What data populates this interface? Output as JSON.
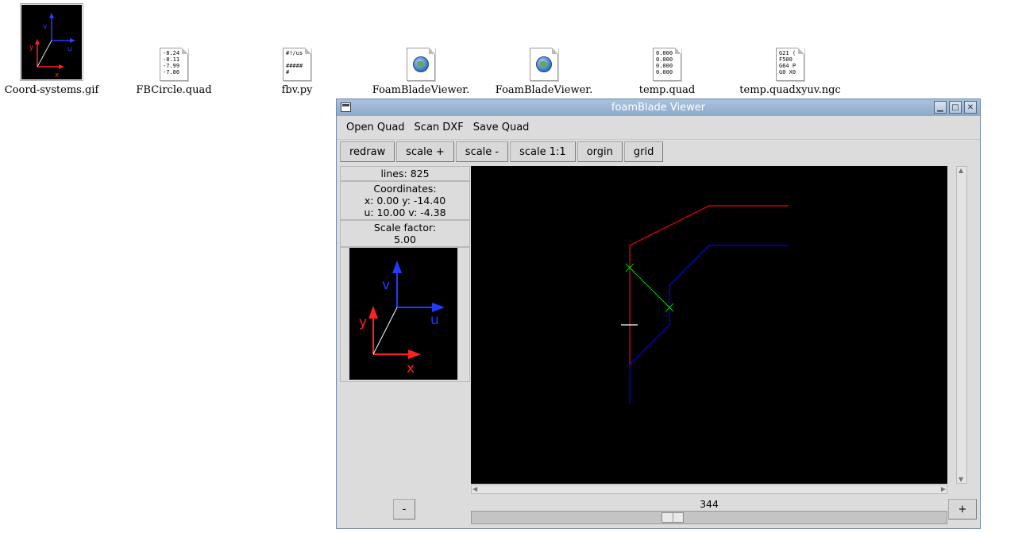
{
  "desktop": {
    "icons": [
      {
        "label": "Coord-systems.gif",
        "type": "image"
      },
      {
        "label": "FBCircle.quad",
        "type": "text",
        "preview": "-8.24\n-8.11\n-7.99\n-7.86"
      },
      {
        "label": "fbv.py",
        "type": "text",
        "preview": "#!/us\n\n#####\n#"
      },
      {
        "label": "FoamBladeViewer.",
        "type": "web"
      },
      {
        "label": "FoamBladeViewer.",
        "type": "web"
      },
      {
        "label": "temp.quad",
        "type": "text",
        "preview": "0.000\n0.000\n0.000\n0.000"
      },
      {
        "label": "temp.quadxyuv.ngc",
        "type": "text",
        "preview": "G21 (\nF500\nG64 P\nG0 X0"
      }
    ],
    "thumb_axes": {
      "v": "v",
      "u": "u",
      "y": "y",
      "x": "x"
    }
  },
  "window": {
    "title": "foamBlade Viewer",
    "buttons": {
      "minimize": "▁",
      "maximize": "□",
      "close": "✕"
    },
    "menu": {
      "open_quad": "Open Quad",
      "scan_dxf": "Scan DXF",
      "save_quad": "Save Quad"
    },
    "toolbar": {
      "redraw": "redraw",
      "scale_plus": "scale +",
      "scale_minus": "scale -",
      "scale_1_1": "scale 1:1",
      "orgin": "orgin",
      "grid": "grid"
    },
    "info": {
      "lines": "lines: 825",
      "coordinates_label": "Coordinates:",
      "xy": "x: 0.00 y: -14.40",
      "uv": "u: 10.00 v: -4.38",
      "scale_label": "Scale factor:",
      "scale_value": "5.00"
    },
    "axes_labels": {
      "v": "v",
      "u": "u",
      "y": "y",
      "x": "x"
    },
    "controls": {
      "minus": "-",
      "plus": "+",
      "slider_value": "344",
      "slider_position": 0.42
    },
    "colors": {
      "xy_path": "#ff0000",
      "uv_path": "#0000ff",
      "link": "#00cc00",
      "cursor": "#ffffff"
    }
  }
}
